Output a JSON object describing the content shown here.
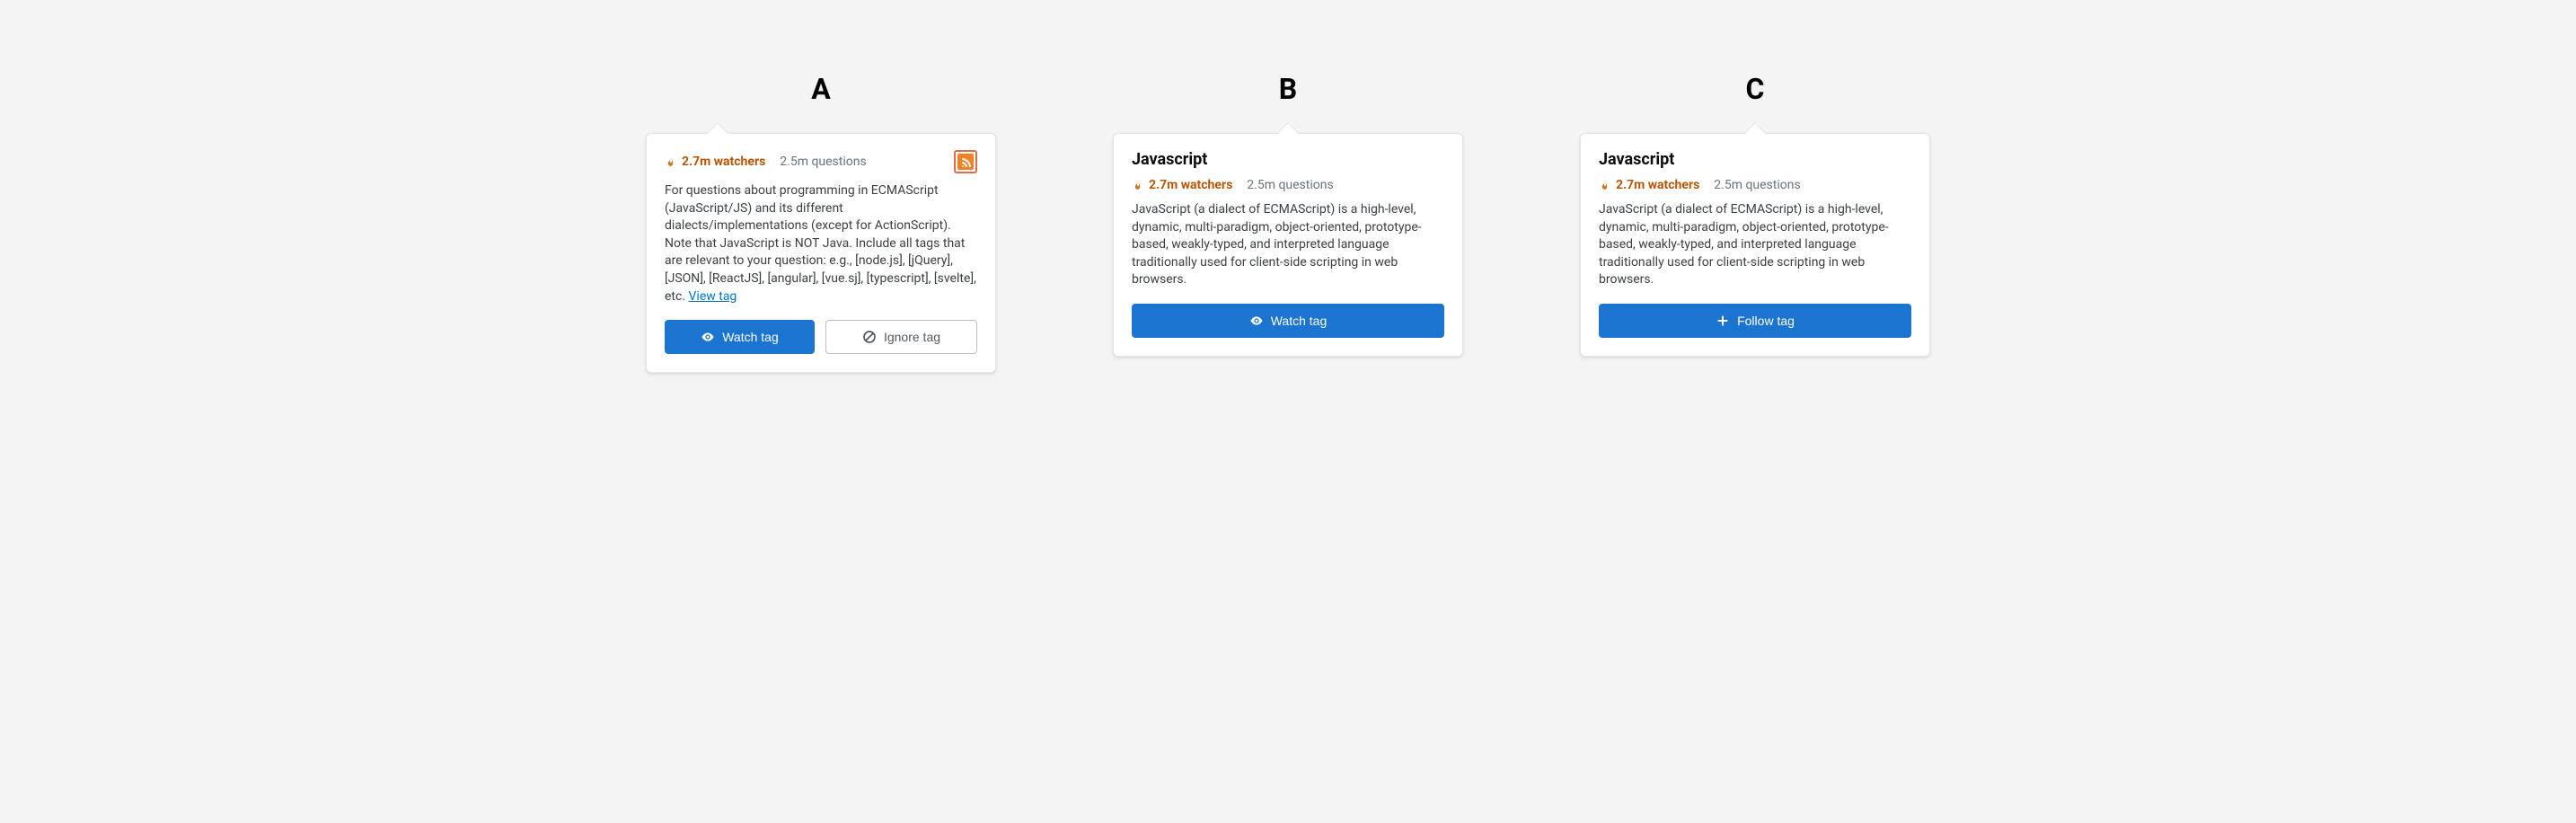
{
  "panels": {
    "a": {
      "label": "A",
      "watchers": "2.7m watchers",
      "questions": "2.5m questions",
      "desc_prefix": "For questions about programming in ECMAScript (JavaScript/JS) and its different dialects/implementations (except for ActionScript). Note that JavaScript is NOT Java. Include all tags that are relevant to your question: e.g., [node.js], [jQuery], [JSON], [ReactJS], [angular], [vue.sj], [typescript], [svelte], etc. ",
      "view_tag": "View tag",
      "watch_label": "Watch tag",
      "ignore_label": "Ignore tag"
    },
    "b": {
      "label": "B",
      "title": "Javascript",
      "watchers": "2.7m watchers",
      "questions": "2.5m questions",
      "desc": "JavaScript (a dialect of ECMAScript) is a high-level, dynamic, multi-paradigm, object-oriented, prototype-based, weakly-typed, and interpreted language traditionally used for client-side scripting in web browsers.",
      "watch_label": "Watch tag"
    },
    "c": {
      "label": "C",
      "title": "Javascript",
      "watchers": "2.7m watchers",
      "questions": "2.5m questions",
      "desc": "JavaScript (a dialect of ECMAScript) is a high-level, dynamic, multi-paradigm, object-oriented, prototype-based, weakly-typed, and interpreted language traditionally used for client-side scripting in web browsers.",
      "follow_label": "Follow tag"
    }
  }
}
